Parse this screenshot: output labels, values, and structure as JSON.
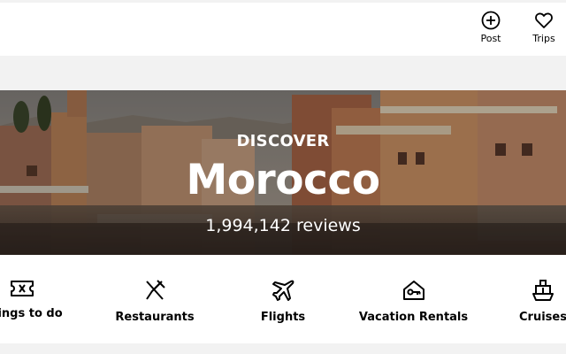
{
  "header": {
    "post_label": "Post",
    "trips_label": "Trips",
    "post_icon": "plus-circle-icon",
    "trips_icon": "heart-icon"
  },
  "hero": {
    "kicker": "DISCOVER",
    "title": "Morocco",
    "reviews": "1,994,142 reviews"
  },
  "categories": [
    {
      "label": "Things to do",
      "icon": "ticket-icon"
    },
    {
      "label": "Restaurants",
      "icon": "fork-knife-icon"
    },
    {
      "label": "Flights",
      "icon": "airplane-icon"
    },
    {
      "label": "Vacation Rentals",
      "icon": "house-key-icon"
    },
    {
      "label": "Cruises",
      "icon": "cruise-ship-icon"
    }
  ],
  "colors": {
    "text": "#000000",
    "band": "#f2f2f2",
    "hero_text": "#ffffff"
  }
}
